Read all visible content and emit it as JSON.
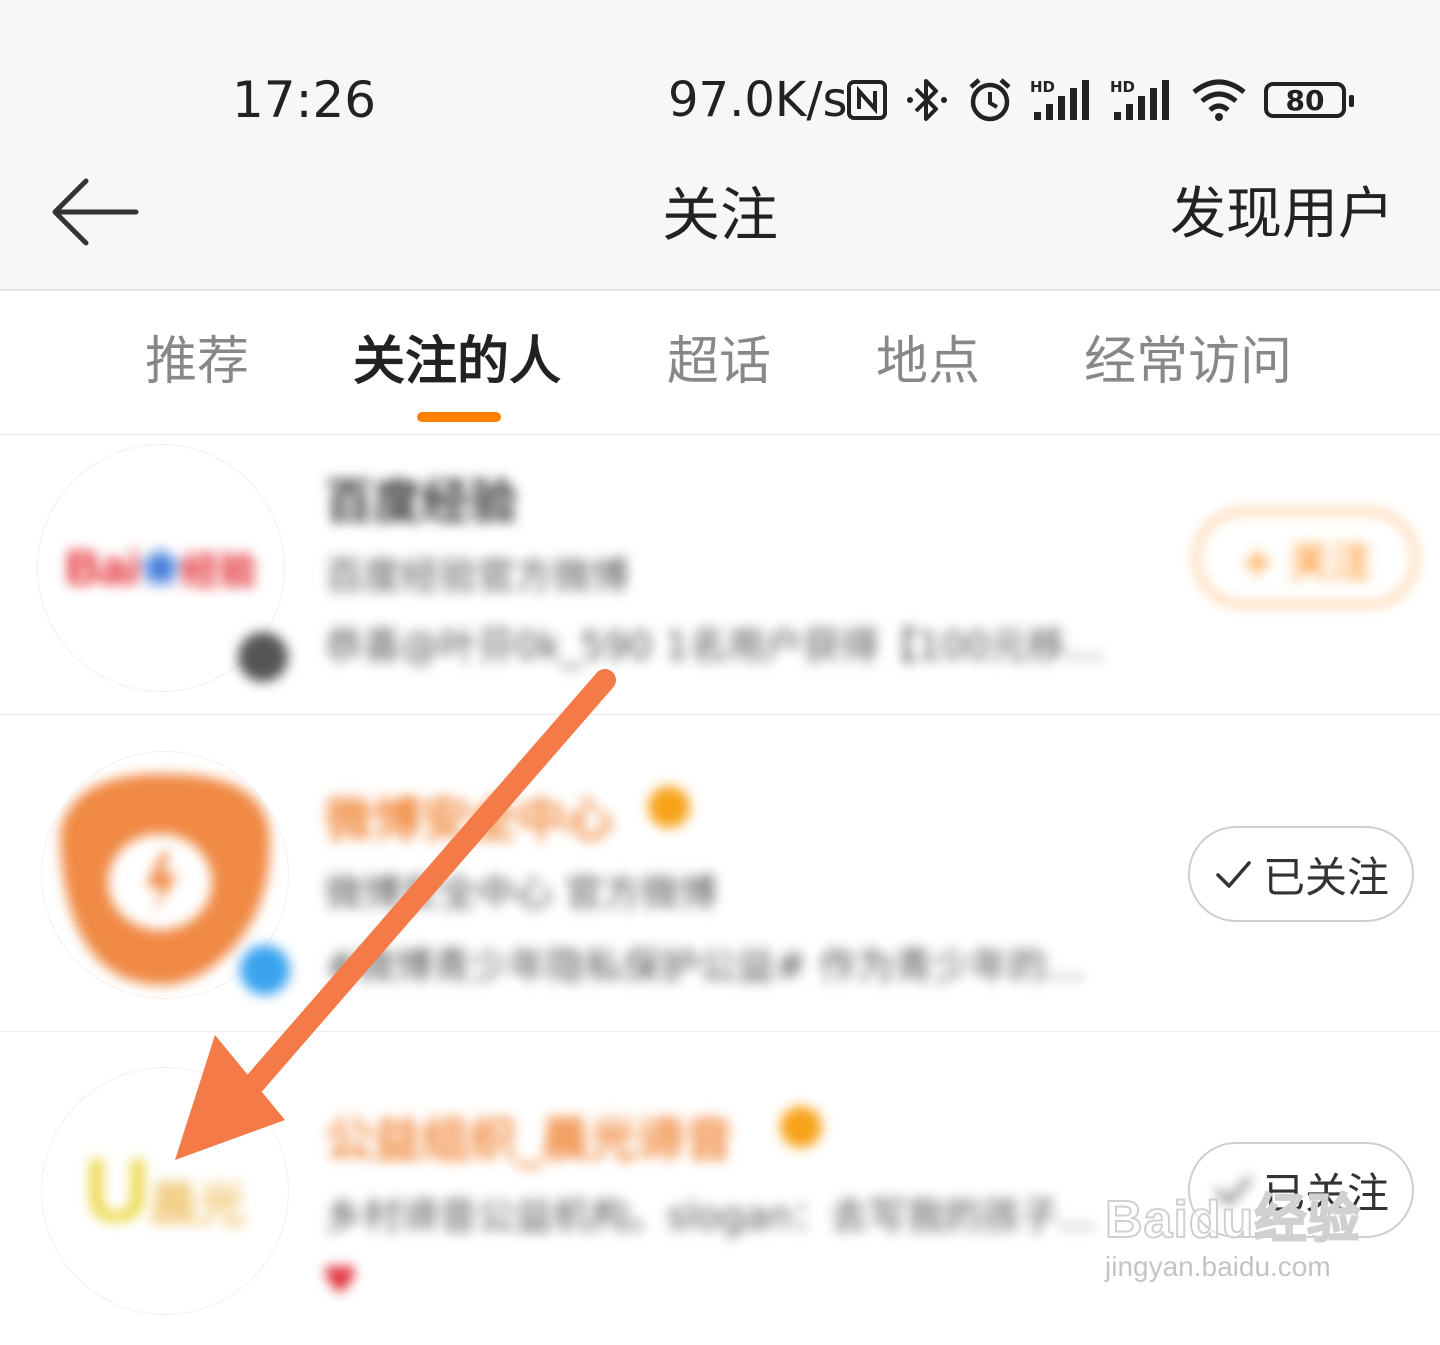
{
  "status_bar": {
    "time": "17:26",
    "network_speed": "97.0K/s",
    "battery": "80",
    "icons": [
      "nfc-icon",
      "bluetooth-icon",
      "alarm-icon",
      "hd-signal-icon",
      "hd-signal-icon",
      "wifi-icon",
      "battery-icon"
    ]
  },
  "nav": {
    "title": "关注",
    "right_action": "发现用户",
    "back_icon": "back-arrow-icon"
  },
  "tabs": [
    {
      "label": "推荐",
      "active": false
    },
    {
      "label": "关注的人",
      "active": true
    },
    {
      "label": "超话",
      "active": false
    },
    {
      "label": "地点",
      "active": false
    },
    {
      "label": "经常访问",
      "active": false
    }
  ],
  "accent_color": "#ff7f00",
  "users": [
    {
      "name": "百度经验",
      "line1": "百度经验官方微博",
      "line2": "恭喜@叶芬0k_590 1名用户获得【100元移…",
      "button": "+ 关注",
      "avatar_text": "Bai 经验"
    },
    {
      "name": "微博安全中心",
      "line1": "微博安全中心 官方微博",
      "line2": "#微博青少年隐私保护公益# 作为青少年的…",
      "button": "已关注",
      "avatar_text": ""
    },
    {
      "name": "公益组织_晨光谛音",
      "line1": "乡村谛音公益机构。slogan：去写我的孩子…",
      "line2": "",
      "button": "已关注",
      "avatar_text": "U 晨光"
    }
  ],
  "watermark": {
    "logo": "Baidu经验",
    "url": "jingyan.baidu.com"
  }
}
